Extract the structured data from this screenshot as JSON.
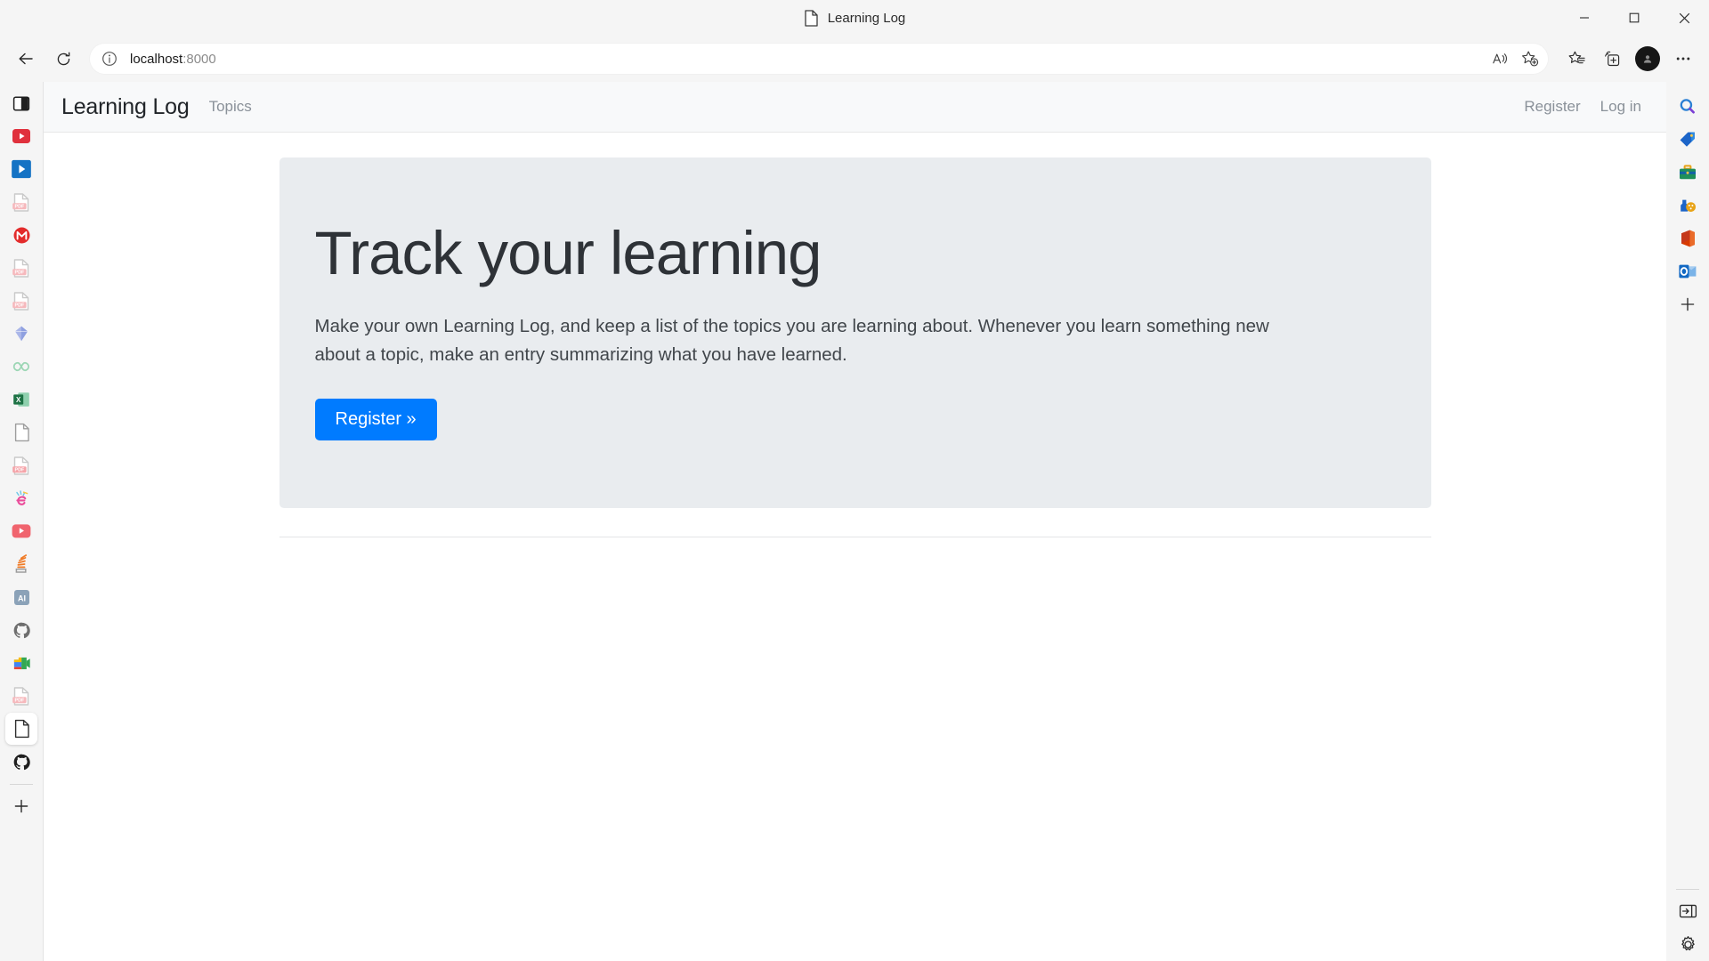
{
  "window": {
    "tab_title": "Learning Log",
    "tab_icon": "document-icon",
    "minimize_label": "Minimize",
    "maximize_label": "Maximize",
    "close_label": "Close"
  },
  "toolbar": {
    "back_label": "Back",
    "refresh_label": "Refresh",
    "url_prefix": "localhost",
    "url_suffix": ":8000",
    "url_full": "localhost:8000",
    "site_info_label": "View site information",
    "read_aloud_label": "Read this page aloud",
    "add_favorite_label": "Add this page to favorites",
    "favorites_label": "Favorites",
    "collections_label": "Collections",
    "profile_label": "Profile",
    "settings_more_label": "Settings and more"
  },
  "left_rail": {
    "items": [
      {
        "icon": "collections-panel-icon",
        "label": "Tab actions",
        "active": false
      },
      {
        "icon": "youtube-icon",
        "label": "YouTube",
        "active": false
      },
      {
        "icon": "video-play-icon",
        "label": "Video",
        "active": false
      },
      {
        "icon": "pdf-file-icon",
        "label": "PDF document",
        "active": false
      },
      {
        "icon": "gmail-icon",
        "label": "Gmail",
        "active": false
      },
      {
        "icon": "pdf-file-icon",
        "label": "PDF document",
        "active": false
      },
      {
        "icon": "pdf-file-icon",
        "label": "PDF document",
        "active": false
      },
      {
        "icon": "sketch-icon",
        "label": "Sketch",
        "active": false
      },
      {
        "icon": "infinity-icon",
        "label": "Infinity",
        "active": false
      },
      {
        "icon": "excel-icon",
        "label": "Excel spreadsheet",
        "active": false
      },
      {
        "icon": "document-icon",
        "label": "Document",
        "active": false
      },
      {
        "icon": "pdf-file-icon",
        "label": "PDF document",
        "active": false
      },
      {
        "icon": "pink-e-icon",
        "label": "Editor",
        "active": false
      },
      {
        "icon": "youtube-icon",
        "label": "YouTube",
        "active": false
      },
      {
        "icon": "stackoverflow-icon",
        "label": "Stack Overflow",
        "active": false
      },
      {
        "icon": "illustrator-icon",
        "label": "Adobe Illustrator",
        "active": false
      },
      {
        "icon": "github-icon",
        "label": "GitHub",
        "active": false
      },
      {
        "icon": "meet-icon",
        "label": "Google Meet",
        "active": false
      },
      {
        "icon": "pdf-file-icon",
        "label": "PDF document",
        "active": false
      },
      {
        "icon": "document-icon",
        "label": "Learning Log",
        "active": true
      },
      {
        "icon": "github-icon",
        "label": "GitHub",
        "active": false
      }
    ],
    "add_tab_label": "New tab"
  },
  "right_rail": {
    "items": [
      {
        "icon": "bing-search-icon",
        "label": "Search"
      },
      {
        "icon": "shopping-tag-icon",
        "label": "Shopping"
      },
      {
        "icon": "tools-icon",
        "label": "Tools"
      },
      {
        "icon": "games-icon",
        "label": "Games"
      },
      {
        "icon": "office-icon",
        "label": "Microsoft Office"
      },
      {
        "icon": "outlook-icon",
        "label": "Outlook"
      },
      {
        "icon": "plus-icon",
        "label": "Customize"
      }
    ],
    "bottom_items": [
      {
        "icon": "sidebar-toggle-icon",
        "label": "Toggle sidebar"
      },
      {
        "icon": "gear-icon",
        "label": "Sidebar settings"
      }
    ]
  },
  "page": {
    "navbar": {
      "brand": "Learning Log",
      "links": [
        {
          "label": "Topics"
        }
      ],
      "right_links": [
        {
          "label": "Register"
        },
        {
          "label": "Log in"
        }
      ]
    },
    "jumbotron": {
      "title": "Track your learning",
      "lead": "Make your own Learning Log, and keep a list of the topics you are learning about. Whenever you learn something new about a topic, make an entry summarizing what you have learned.",
      "cta_label": "Register »"
    }
  },
  "colors": {
    "primary": "#007bff",
    "jumbotron_bg": "#e9ecef",
    "navbar_bg": "#f8f9fa",
    "chrome_bg": "#f5f5f5",
    "heading": "#2e3237",
    "muted_link": "#8a9199"
  }
}
